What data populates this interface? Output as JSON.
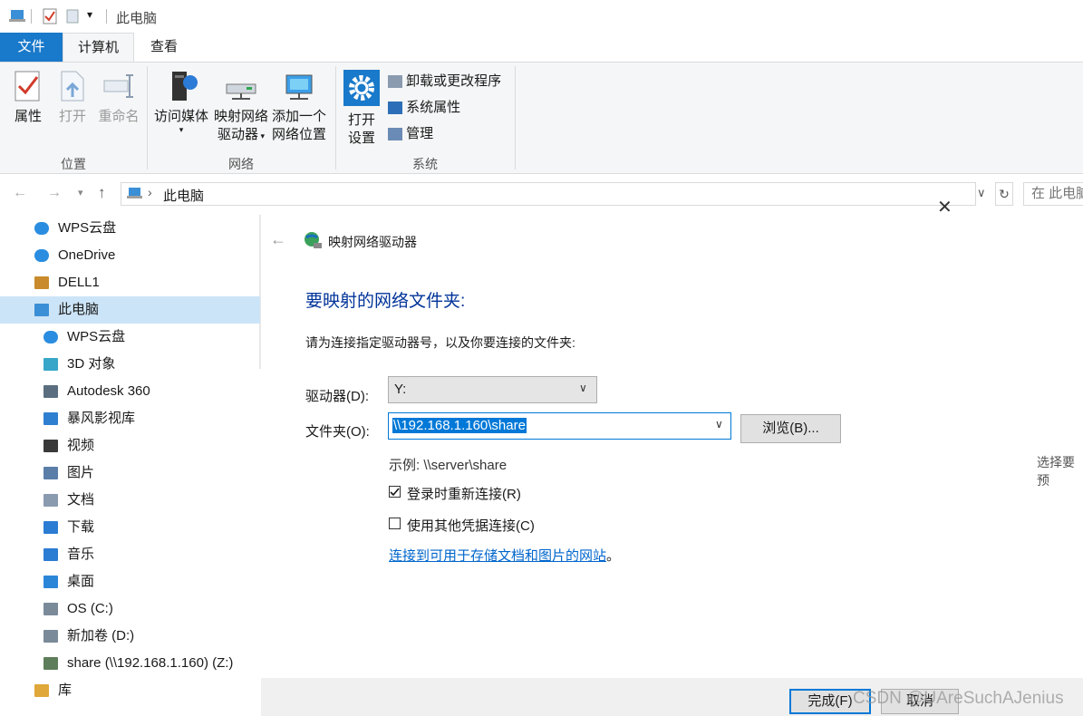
{
  "window": {
    "title": "此电脑"
  },
  "ribbon": {
    "tabs": {
      "file": "文件",
      "computer": "计算机",
      "view": "查看"
    },
    "location": {
      "properties": "属性",
      "open": "打开",
      "rename": "重命名",
      "group": "位置"
    },
    "network": {
      "media": "访问媒体",
      "map_drive_1": "映射网络",
      "map_drive_2": "驱动器",
      "add_location_1": "添加一个",
      "add_location_2": "网络位置",
      "group": "网络"
    },
    "system": {
      "settings_1": "打开",
      "settings_2": "设置",
      "uninstall": "卸载或更改程序",
      "sys_props": "系统属性",
      "manage": "管理",
      "group": "系统"
    }
  },
  "address": {
    "location": "此电脑",
    "search_placeholder": "在 此电脑"
  },
  "nav": {
    "items": [
      {
        "label": "WPS云盘",
        "icon": "cloud-icon"
      },
      {
        "label": "OneDrive",
        "icon": "cloud-icon"
      },
      {
        "label": "DELL1",
        "icon": "user-folder-icon"
      },
      {
        "label": "此电脑",
        "icon": "computer-icon"
      },
      {
        "label": "WPS云盘",
        "icon": "cloud-icon"
      },
      {
        "label": "3D 对象",
        "icon": "cube-icon"
      },
      {
        "label": "Autodesk 360",
        "icon": "autodesk-icon"
      },
      {
        "label": "暴风影视库",
        "icon": "media-library-icon"
      },
      {
        "label": "视频",
        "icon": "video-icon"
      },
      {
        "label": "图片",
        "icon": "picture-icon"
      },
      {
        "label": "文档",
        "icon": "document-icon"
      },
      {
        "label": "下载",
        "icon": "download-icon"
      },
      {
        "label": "音乐",
        "icon": "music-icon"
      },
      {
        "label": "桌面",
        "icon": "desktop-icon"
      },
      {
        "label": "OS (C:)",
        "icon": "drive-icon"
      },
      {
        "label": "新加卷 (D:)",
        "icon": "drive-icon"
      },
      {
        "label": "share (\\\\192.168.1.160) (Z:)",
        "icon": "network-drive-icon"
      },
      {
        "label": "库",
        "icon": "library-icon"
      }
    ]
  },
  "dialog": {
    "title": "映射网络驱动器",
    "heading": "要映射的网络文件夹:",
    "instruction": "请为连接指定驱动器号，以及你要连接的文件夹:",
    "drive_label": "驱动器(D):",
    "drive_value": "Y:",
    "folder_label": "文件夹(O):",
    "folder_value": "\\\\192.168.1.160\\share",
    "browse_label": "浏览(B)...",
    "example": "示例: \\\\server\\share",
    "side_hint": "选择要预",
    "reconnect_label": "登录时重新连接(R)",
    "reconnect_checked": true,
    "other_cred_label": "使用其他凭据连接(C)",
    "other_cred_checked": false,
    "link_text": "连接到可用于存储文档和图片的网站",
    "link_suffix": "。",
    "finish_label": "完成(F)",
    "cancel_label": "取消"
  },
  "watermark": "CSDN @UAreSuchAJenius",
  "colors": {
    "accent": "#1979ca",
    "selection": "#cce4f7",
    "link": "#0066cc",
    "heading": "#003399"
  }
}
